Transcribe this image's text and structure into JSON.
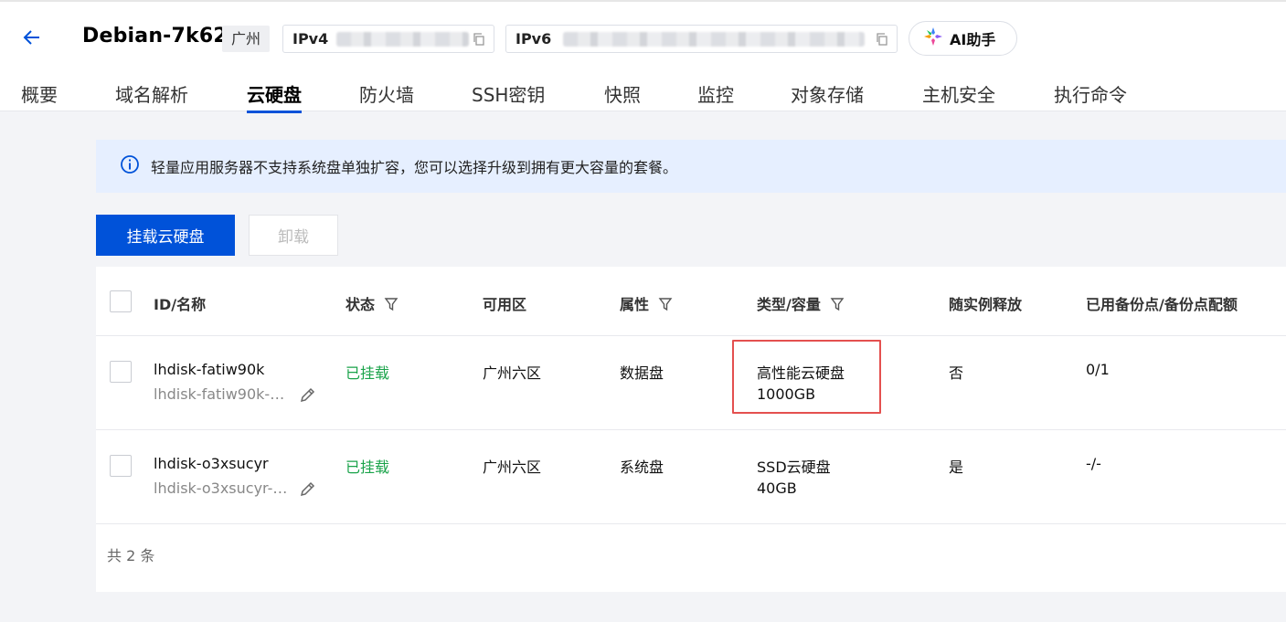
{
  "header": {
    "title": "Debian-7k62",
    "region": "广州",
    "ipv4_label": "IPv4",
    "ipv6_label": "IPv6",
    "ai_label": "AI助手"
  },
  "tabs": [
    {
      "label": "概要"
    },
    {
      "label": "域名解析"
    },
    {
      "label": "云硬盘",
      "active": true
    },
    {
      "label": "防火墙"
    },
    {
      "label": "SSH密钥"
    },
    {
      "label": "快照"
    },
    {
      "label": "监控"
    },
    {
      "label": "对象存储"
    },
    {
      "label": "主机安全"
    },
    {
      "label": "执行命令"
    }
  ],
  "notice": {
    "text": "轻量应用服务器不支持系统盘单独扩容，您可以选择升级到拥有更大容量的套餐。"
  },
  "toolbar": {
    "attach_label": "挂载云硬盘",
    "detach_label": "卸载"
  },
  "table": {
    "columns": {
      "id": "ID/名称",
      "status": "状态",
      "zone": "可用区",
      "attr": "属性",
      "type": "类型/容量",
      "release": "随实例释放",
      "backup": "已用备份点/备份点配额"
    },
    "rows": [
      {
        "id": "lhdisk-fatiw90k",
        "name": "lhdisk-fatiw90k-…",
        "status": "已挂载",
        "zone": "广州六区",
        "attr": "数据盘",
        "type": "高性能云硬盘",
        "capacity": "1000GB",
        "release": "否",
        "backup": "0/1"
      },
      {
        "id": "lhdisk-o3xsucyr",
        "name": "lhdisk-o3xsucyr-…",
        "status": "已挂载",
        "zone": "广州六区",
        "attr": "系统盘",
        "type": "SSD云硬盘",
        "capacity": "40GB",
        "release": "是",
        "backup": "-/-"
      }
    ],
    "total": "共 2 条"
  },
  "colors": {
    "primary": "#0052d9",
    "success": "#1aa34a",
    "highlight": "#e4504f",
    "notice_bg": "#e6efff"
  }
}
